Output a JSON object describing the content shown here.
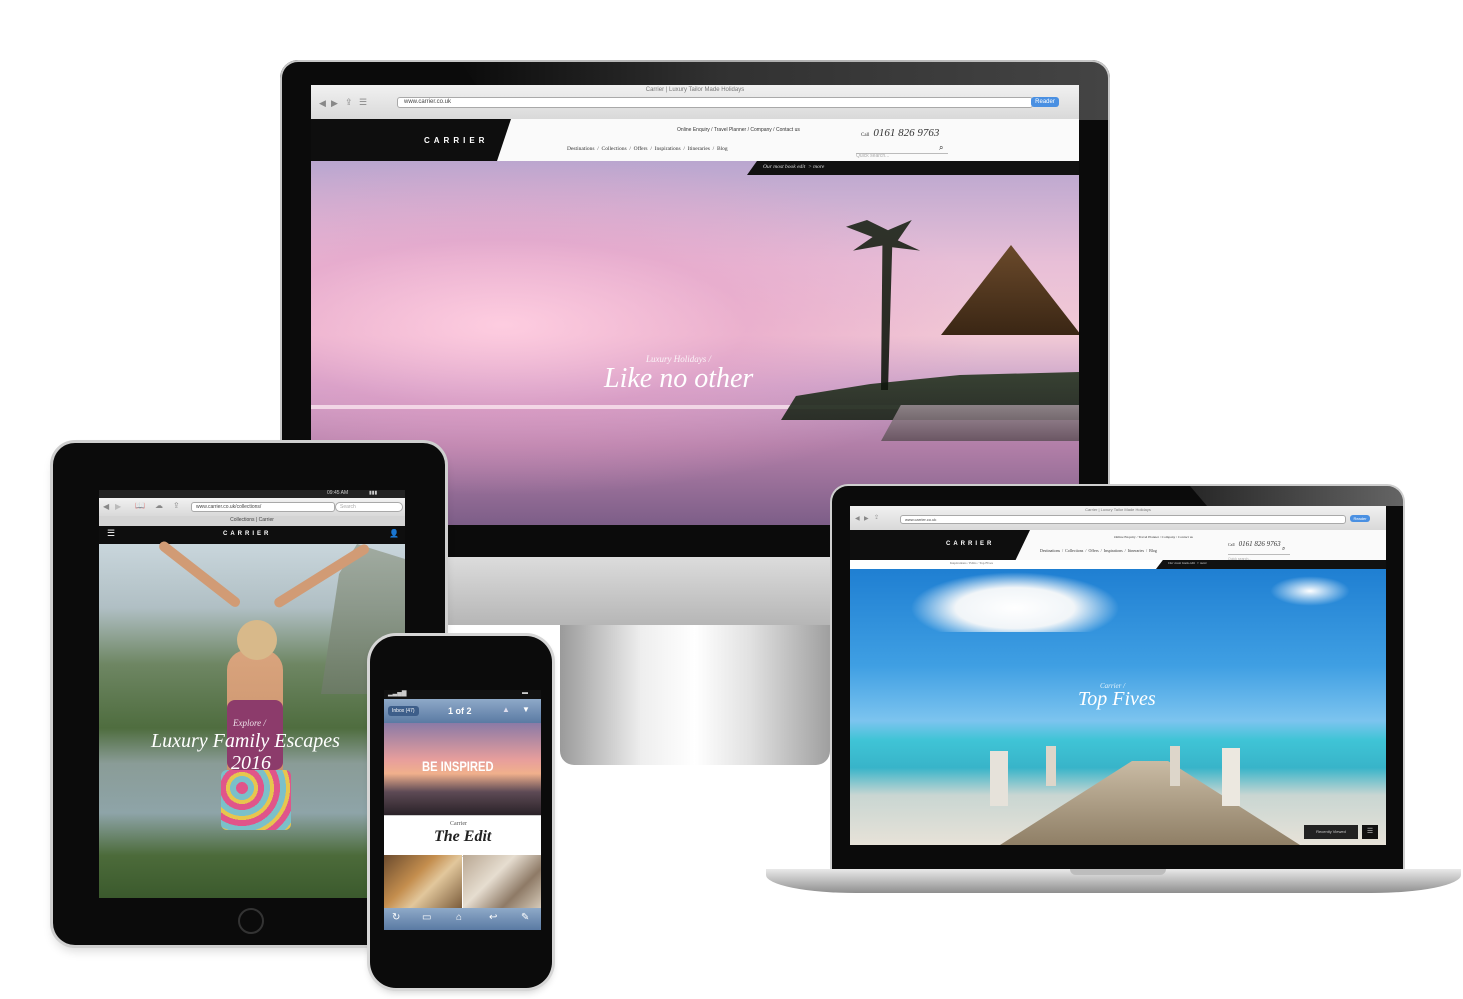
{
  "desktop": {
    "browser_title": "Carrier | Luxury Tailor Made Holidays",
    "url": "www.carrier.co.uk",
    "reader_label": "Reader",
    "logo": "CARRIER",
    "top_links": [
      "Online Enquiry",
      "Travel Planner",
      "Company",
      "Contact us"
    ],
    "phone_prefix": "Call",
    "phone": "0161 826 9763",
    "nav": [
      "Destinations",
      "Collections",
      "Offers",
      "Inspirations",
      "Itineraries",
      "Blog"
    ],
    "search_placeholder": "Quick search...",
    "promo_text": "Our most book edit",
    "promo_link": "> more",
    "hero_kicker": "Luxury Holidays /",
    "hero_title": "Like no other"
  },
  "tablet": {
    "status_time": "09:45 AM",
    "url": "www.carrier.co.uk/collections/",
    "search_placeholder": "Search",
    "page_title": "Collections | Carrier",
    "logo": "CARRIER",
    "hero_kicker": "Explore /",
    "hero_title_line1": "Luxury Family Escapes",
    "hero_title_line2": "2016"
  },
  "phone": {
    "back_label": "Inbox (47)",
    "pager": "1 of 2",
    "banner_title": "BE INSPIRED",
    "edit_kicker": "Carrier",
    "edit_title": "The Edit"
  },
  "laptop": {
    "browser_title": "Carrier | Luxury Tailor Made Holidays",
    "url": "www.carrier.co.uk",
    "reader_label": "Reader",
    "logo": "CARRIER",
    "top_links": [
      "Online Enquiry",
      "Travel Planner",
      "Company",
      "Contact us"
    ],
    "phone_prefix": "Call",
    "phone": "0161 826 9763",
    "nav": [
      "Destinations",
      "Collections",
      "Offers",
      "Inspirations",
      "Itineraries",
      "Blog"
    ],
    "search_placeholder": "Quick search...",
    "breadcrumb": "Inspirations / Edits / Top Fives",
    "promo_text": "Our most book edit",
    "promo_link": "> more",
    "hero_kicker": "Carrier /",
    "hero_title": "Top Fives",
    "cta_label": "Recently Viewed"
  },
  "colors": {
    "accent_blue": "#4a90e2",
    "brand_black": "#0e0e0e",
    "sunset_pink": "#c98cae",
    "sea_turquoise": "#3fc4d6"
  }
}
